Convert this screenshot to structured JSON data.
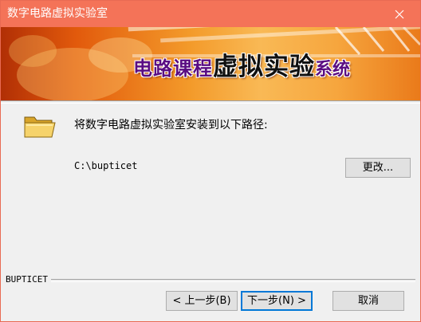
{
  "window": {
    "title": "数字电路虚拟实验室",
    "close_icon": "close-icon"
  },
  "banner": {
    "title_part1": "电路课程",
    "title_part2": "虚拟实验",
    "title_part3": "系统"
  },
  "content": {
    "folder_icon": "folder-icon",
    "prompt": "将数字电路虚拟实验室安装到以下路径:",
    "path": "C:\\bupticet",
    "change_button": "更改..."
  },
  "footer": {
    "brand": "BUPTICET",
    "back_button": "< 上一步(B)",
    "next_button": "下一步(N) >",
    "cancel_button": "取消"
  },
  "colors": {
    "titlebar": "#f47358",
    "banner_text": "#5a0d82",
    "focus_border": "#0078d7"
  }
}
